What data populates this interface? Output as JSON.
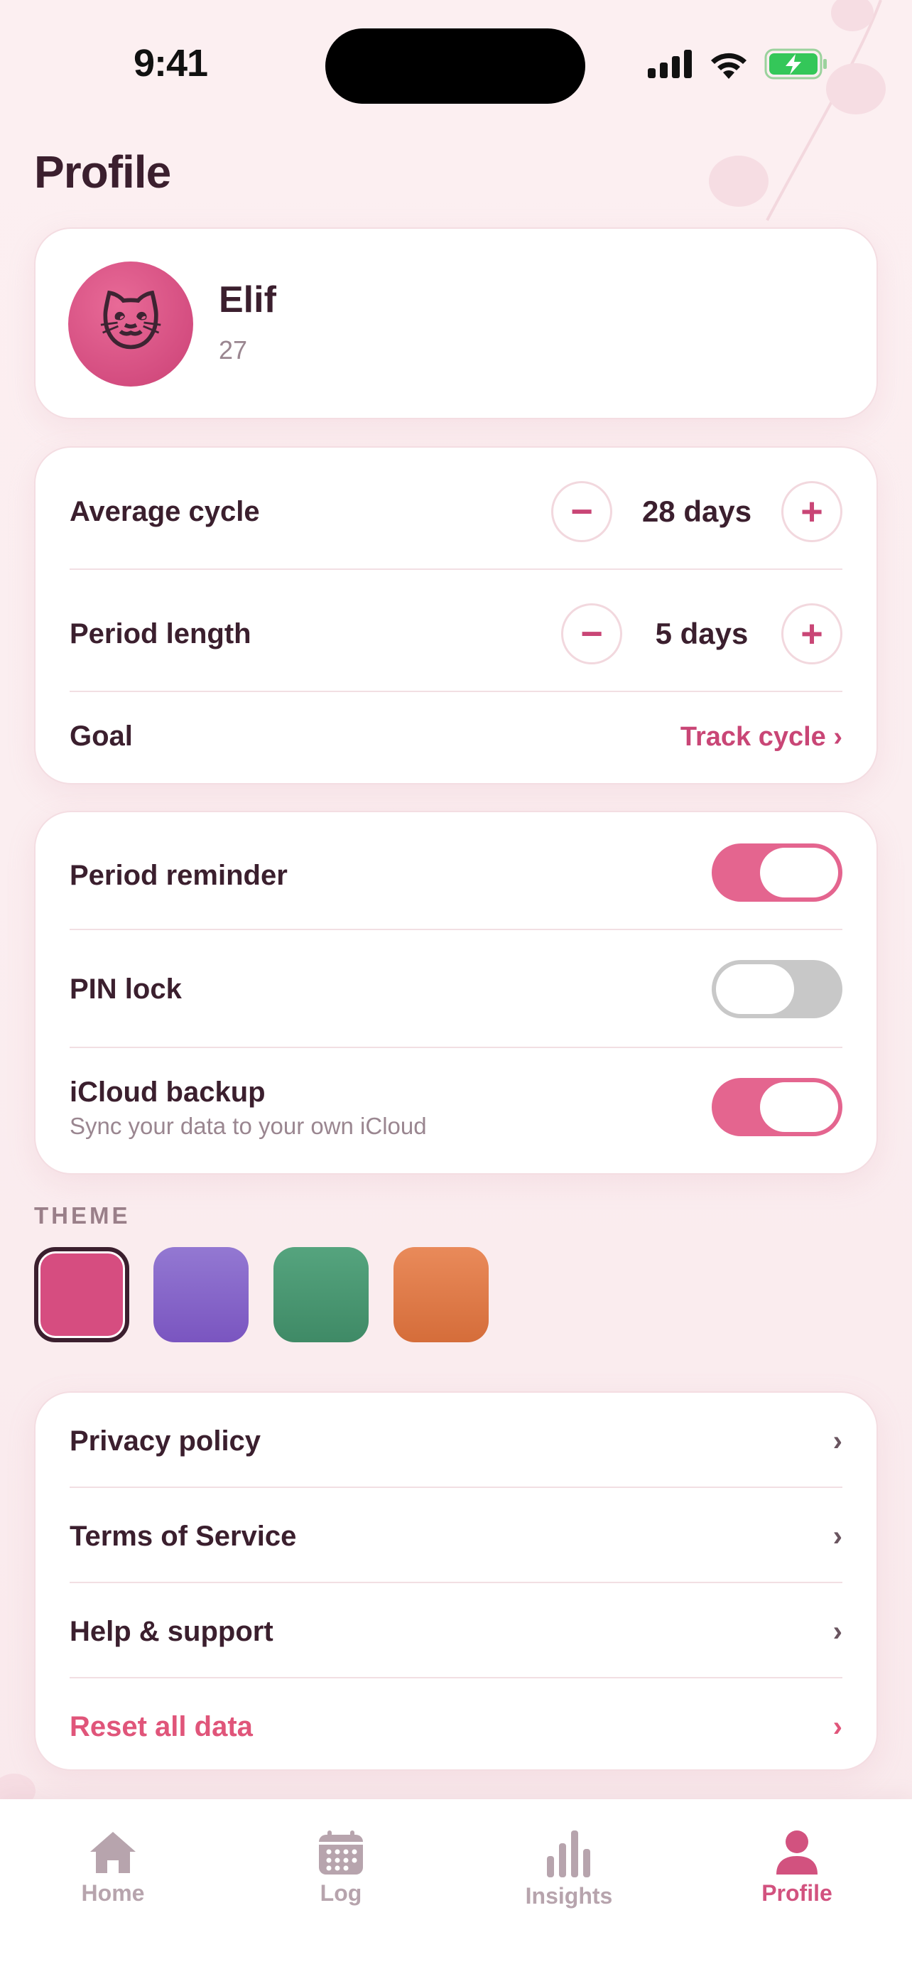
{
  "status_bar": {
    "time": "9:41"
  },
  "page_title": "Profile",
  "profile": {
    "name": "Elif",
    "age": "27",
    "avatar_emoji": "🐱"
  },
  "cycle": {
    "average_cycle": {
      "label": "Average cycle",
      "value": "28 days",
      "minus": "−",
      "plus": "+"
    },
    "period_length": {
      "label": "Period length",
      "value": "5 days",
      "minus": "−",
      "plus": "+"
    },
    "goal": {
      "label": "Goal",
      "value": "Track cycle ›"
    }
  },
  "settings": {
    "period_reminder": {
      "label": "Period reminder",
      "on": true
    },
    "pin_lock": {
      "label": "PIN lock",
      "on": false
    },
    "icloud_backup": {
      "label": "iCloud backup",
      "sub": "Sync your data to your own iCloud",
      "on": true
    }
  },
  "theme": {
    "label": "THEME",
    "swatches": [
      {
        "name": "pink",
        "color": "#d64d80",
        "selected": true
      },
      {
        "name": "purple",
        "color": "#8a66c9",
        "selected": false
      },
      {
        "name": "green",
        "color": "#4a9a73",
        "selected": false
      },
      {
        "name": "orange",
        "color": "#e07a48",
        "selected": false
      }
    ]
  },
  "links": {
    "privacy": "Privacy policy",
    "terms": "Terms of Service",
    "help": "Help & support",
    "reset": "Reset all data",
    "chevron": "›"
  },
  "tabs": [
    {
      "label": "Home",
      "icon": "home-icon",
      "active": false
    },
    {
      "label": "Log",
      "icon": "calendar-icon",
      "active": false
    },
    {
      "label": "Insights",
      "icon": "bar-chart-icon",
      "active": false
    },
    {
      "label": "Profile",
      "icon": "person-icon",
      "active": true
    }
  ],
  "colors": {
    "accent": "#d2527f",
    "text": "#3b1f2e",
    "muted": "#9a8690",
    "toggle_on": "#e4658f",
    "toggle_off": "#c8c8c8"
  }
}
